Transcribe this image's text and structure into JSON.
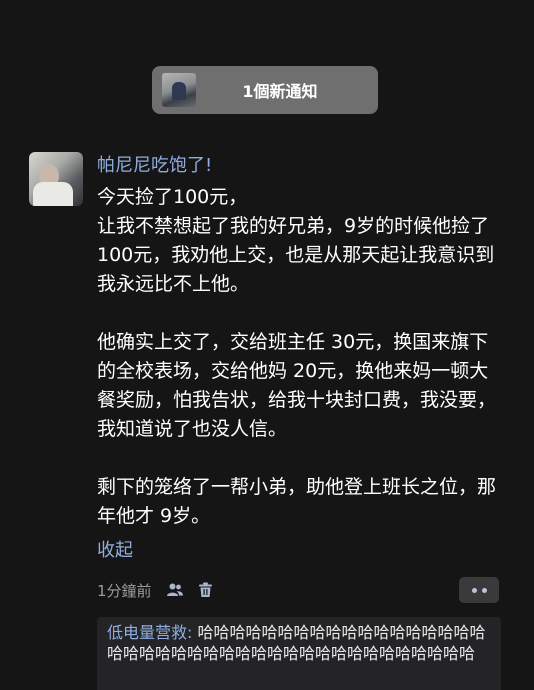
{
  "notification": {
    "label": "1個新通知"
  },
  "comment": {
    "username": "帕尼尼吃饱了!",
    "paragraphs": [
      "今天捡了100元，\n让我不禁想起了我的好兄弟，9岁的时候他捡了 100元，我劝他上交，也是从那天起让我意识到我永远比不上他。",
      "他确实上交了，交给班主任 30元，换国来旗下的全校表场，交给他妈 20元，换他来妈一顿大餐奖励，怕我告状，给我十块封口费，我没要，我知道说了也没人信。",
      "剩下的笼络了一帮小弟，助他登上班长之位，那年他才 9岁。"
    ],
    "collapse_label": "收起",
    "timestamp": "1分鐘前",
    "icons": [
      "people-icon",
      "trash-icon",
      "more-icon"
    ]
  },
  "reply": {
    "username": "低电量营救:",
    "text": " 哈哈哈哈哈哈哈哈哈哈哈哈哈哈哈哈哈哈哈哈哈哈哈哈哈哈哈哈哈哈哈哈哈哈哈哈哈哈哈哈哈"
  },
  "colors": {
    "background": "#151516",
    "link": "#8faee0",
    "notification_bg": "#6f6f6f",
    "reply_bg": "#242426"
  }
}
